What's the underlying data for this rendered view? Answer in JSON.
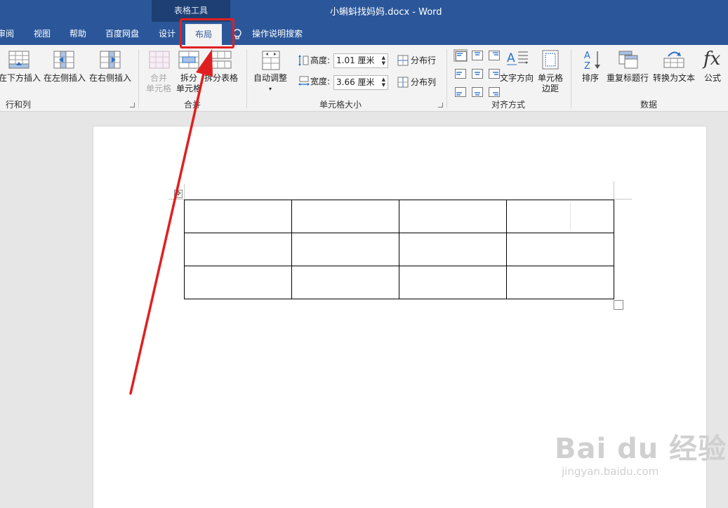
{
  "window": {
    "context_label": "表格工具",
    "doc_title": "小蝌蚪找妈妈.docx  -  Word"
  },
  "tabs": [
    {
      "label": "审阅"
    },
    {
      "label": "视图"
    },
    {
      "label": "帮助"
    },
    {
      "label": "百度网盘"
    },
    {
      "label": "设计"
    },
    {
      "label": "布局",
      "active": true
    },
    {
      "label": "操作说明搜索"
    }
  ],
  "ribbon": {
    "rows_cols": {
      "insert_below": "在下方插入",
      "insert_left": "在左侧插入",
      "insert_right": "在右侧插入",
      "group_label": "行和列"
    },
    "merge": {
      "merge_cells_1": "合并",
      "merge_cells_2": "单元格",
      "split_cells_1": "拆分",
      "split_cells_2": "单元格",
      "split_table": "拆分表格",
      "group_label": "合并"
    },
    "cell_size": {
      "autofit": "自动调整",
      "height_label": "高度:",
      "height_value": "1.01 厘米",
      "width_label": "宽度:",
      "width_value": "3.66 厘米",
      "distribute_rows": "分布行",
      "distribute_cols": "分布列",
      "group_label": "单元格大小"
    },
    "alignment": {
      "text_direction": "文字方向",
      "cell_margins_1": "单元格",
      "cell_margins_2": "边距",
      "group_label": "对齐方式"
    },
    "data": {
      "sort": "排序",
      "repeat_header": "重复标题行",
      "convert_to_text": "转换为文本",
      "formula": "公式",
      "formula_glyph": "fx",
      "group_label": "数据"
    }
  },
  "table": {
    "rows": 3,
    "cols": 4
  },
  "watermark": {
    "main": "Bai du 经验",
    "url": "jingyan.baidu.com"
  },
  "colors": {
    "accent": "#2b579a",
    "annotation": "#e02020"
  }
}
